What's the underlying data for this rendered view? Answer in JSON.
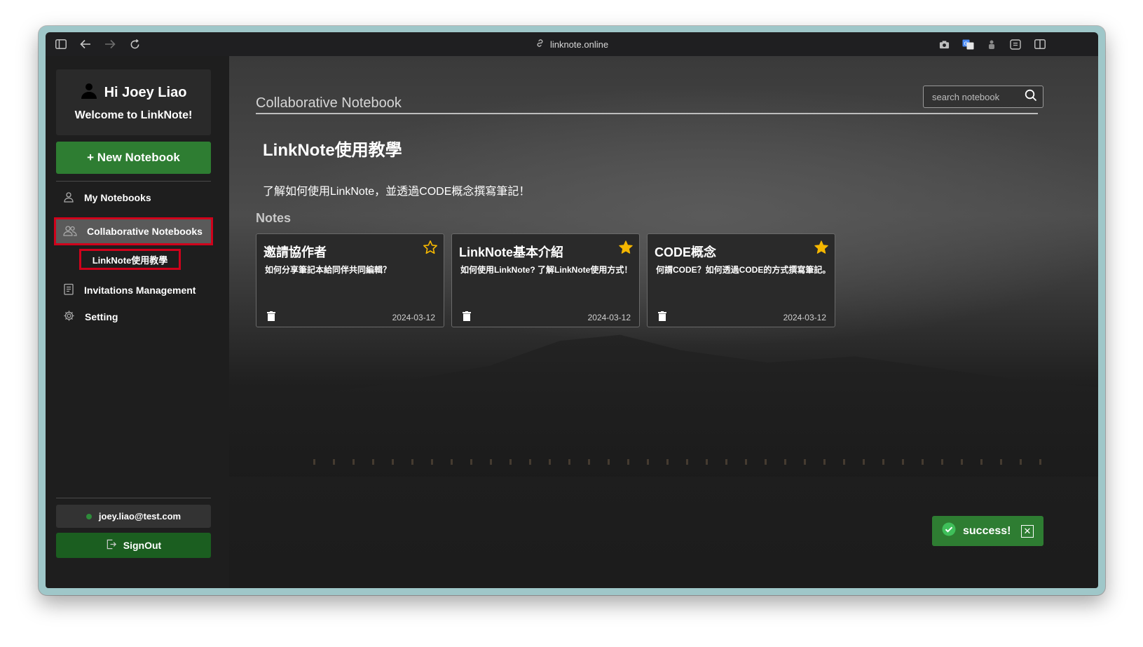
{
  "browser": {
    "url": "linknote.online",
    "icons": [
      "sidebar-toggle-icon",
      "back-arrow-icon",
      "forward-arrow-icon",
      "reload-icon",
      "link-icon",
      "camera-icon",
      "translate-icon",
      "extension-icon",
      "reader-icon",
      "split-view-icon"
    ]
  },
  "sidebar": {
    "greeting": "Hi Joey Liao",
    "welcome": "Welcome to LinkNote!",
    "new_notebook": "+ New Notebook",
    "items": [
      {
        "label": "My Notebooks",
        "icon": "user-icon"
      },
      {
        "label": "Collaborative Notebooks",
        "icon": "group-icon",
        "active": true
      },
      {
        "label": "Invitations Management",
        "icon": "clipboard-icon"
      },
      {
        "label": "Setting",
        "icon": "gear-icon"
      }
    ],
    "sub_item": "LinkNote使用教學",
    "email": "joey.liao@test.com",
    "signout": "SignOut"
  },
  "main": {
    "page_title": "Collaborative Notebook",
    "search_placeholder": "search notebook",
    "notebook_title": "LinkNote使用教學",
    "notebook_description": "了解如何使用LinkNote，並透過CODE概念撰寫筆記！",
    "notes_heading": "Notes",
    "notes": [
      {
        "title": "邀請協作者",
        "description": "如何分享筆記本給同伴共同編輯？",
        "date": "2024-03-12",
        "starred": false
      },
      {
        "title": "LinkNote基本介紹",
        "description": "如何使用LinkNote? 了解LinkNote使用方式！",
        "date": "2024-03-12",
        "starred": true
      },
      {
        "title": "CODE概念",
        "description": "何謂CODE？如何透過CODE的方式撰寫筆記。",
        "date": "2024-03-12",
        "starred": true
      }
    ]
  },
  "toast": {
    "message": "success!"
  },
  "colors": {
    "accent_green": "#2e7d32",
    "star_gold": "#f5b700",
    "highlight_red": "#d0021b"
  }
}
